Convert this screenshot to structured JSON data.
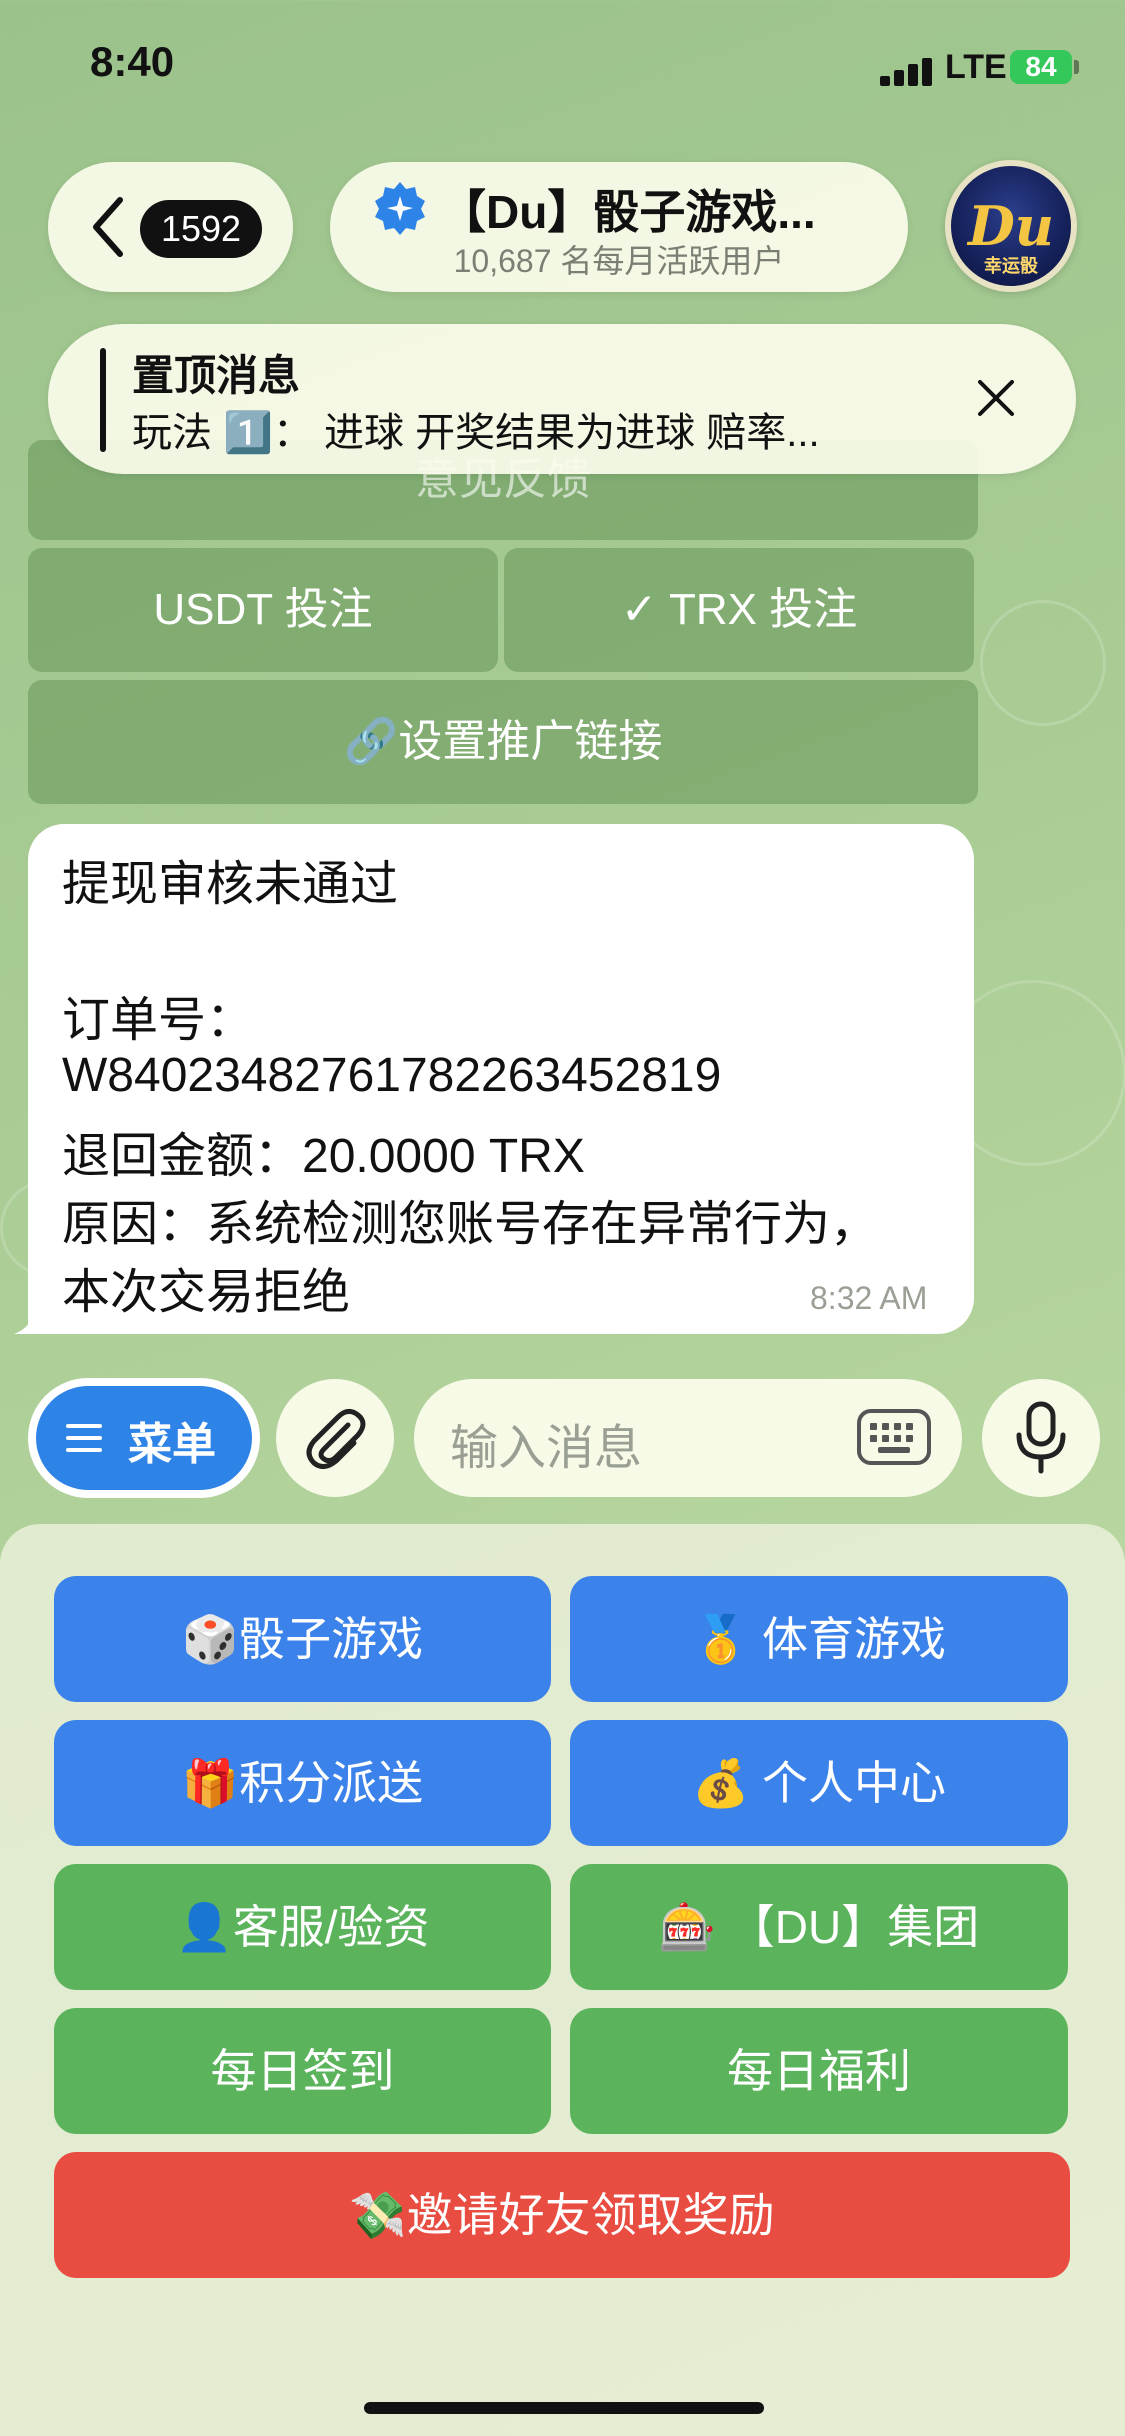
{
  "status_bar": {
    "time": "8:40",
    "network": "LTE",
    "battery": "84"
  },
  "header": {
    "back_count": "1592",
    "title": "【Du】骰子游戏...",
    "subtitle": "10,687 名每月活跃用户",
    "avatar_text": "Du",
    "avatar_sub": "幸运骰"
  },
  "pinned": {
    "title": "置顶消息",
    "text": "玩法 1️⃣： 进球 开奖结果为进球 赔率..."
  },
  "inline_keyboard": {
    "feedback": "意见反馈",
    "usdt": "USDT 投注",
    "trx": "✓ TRX 投注",
    "referral": "🔗设置推广链接"
  },
  "message": {
    "lines": [
      "提现审核未通过",
      "",
      "订单号：",
      "W840234827617822634528​19",
      "退回金额：20.0000 TRX",
      "原因：系统检测您账号存在异常行为，",
      "本次交易拒绝"
    ],
    "time": "8:32 AM"
  },
  "input_bar": {
    "menu_label": "菜单",
    "placeholder": "输入消息"
  },
  "reply_keyboard": {
    "dice": "🎲骰子游戏",
    "sports": "🥇 体育游戏",
    "points": "🎁积分派送",
    "profile": "💰 个人中心",
    "support": "👤客服/验资",
    "group": "🎰 【DU】集团",
    "checkin": "每日签到",
    "welfare": "每日福利",
    "invite": "💸邀请好友领取奖励"
  },
  "colors": {
    "blue": "#3b82ea",
    "green": "#5bb35c",
    "red": "#e94d41"
  }
}
